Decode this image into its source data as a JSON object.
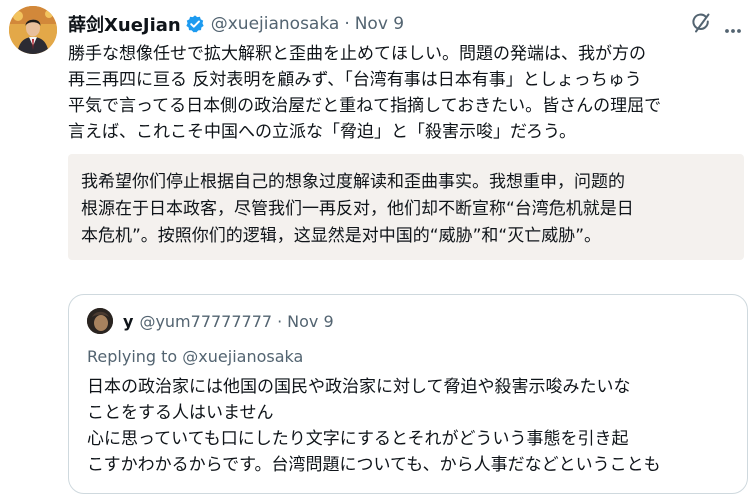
{
  "tweet": {
    "display_name": "薛剑XueJian",
    "handle": "@xuejianosaka",
    "separator": "·",
    "date": "Nov 9",
    "text_lines": [
      "勝手な想像任せで拡大解釈と歪曲を止めてほしい。問題の発端は、我が方の",
      "再三再四に亘る 反対表明を顧みず、「台湾有事は日本有事」としょっちゅう",
      "平気で言ってる日本側の政治屋だと重ねて指摘しておきたい。皆さんの理屈で",
      "言えば、これこそ中国への立派な「脅迫」と「殺害示唆」だろう。"
    ],
    "translation_lines": [
      "我希望你们停止根据自己的想象过度解读和歪曲事实。我想重申，问题的",
      "根源在于日本政客，尽管我们一再反对，他们却不断宣称“台湾危机就是日",
      "本危机”。按照你们的逻辑，这显然是对中国的“威胁”和“灭亡威胁”。"
    ]
  },
  "quote": {
    "display_name": "y",
    "handle": "@yum77777777",
    "separator": "·",
    "date": "Nov 9",
    "replying_prefix": "Replying to",
    "replying_handle": "@xuejianosaka",
    "text_lines": [
      "日本の政治家には他国の国民や政治家に対して脅迫や殺害示唆みたいな",
      "ことをする人はいません",
      "心に思っていても口にしたり文字にするとそれがどういう事態を引き起",
      "こすかわかるからです。台湾問題についても、から人事だなどということも"
    ]
  },
  "icons": {
    "verified": "verified-badge-icon",
    "grok": "grok-icon",
    "more": "more-options-icon"
  },
  "colors": {
    "accent": "#1d9bf0",
    "secondary_text": "#536471",
    "translation_bg": "#f4f1ee",
    "border": "#cfd9de"
  }
}
